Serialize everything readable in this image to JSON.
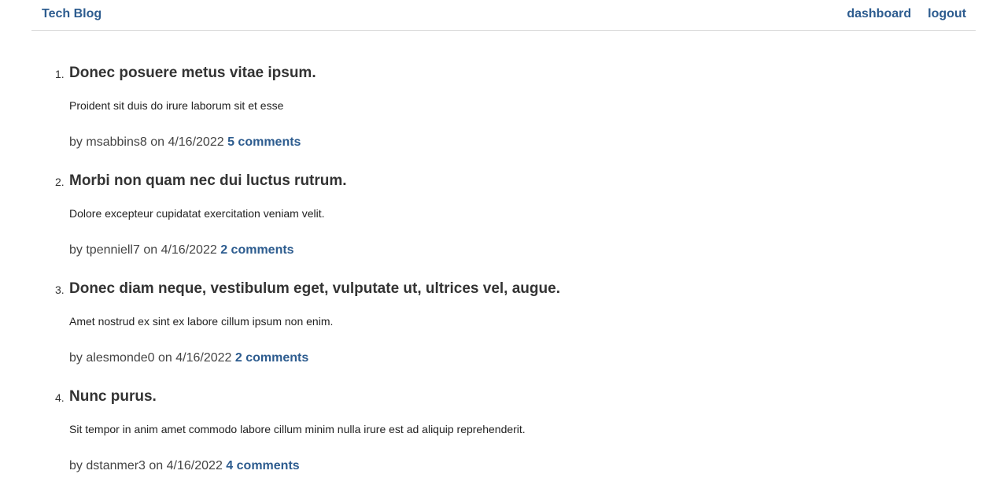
{
  "header": {
    "brand": "Tech Blog",
    "nav": {
      "dashboard": "dashboard",
      "logout": "logout"
    }
  },
  "meta_labels": {
    "by": "by",
    "on": "on"
  },
  "posts": [
    {
      "number": "1.",
      "title": "Donec posuere metus vitae ipsum.",
      "body": "Proident sit duis do irure laborum sit et esse",
      "author": "msabbins8",
      "date": "4/16/2022",
      "comments": "5 comments"
    },
    {
      "number": "2.",
      "title": "Morbi non quam nec dui luctus rutrum.",
      "body": "Dolore excepteur cupidatat exercitation veniam velit.",
      "author": "tpenniell7",
      "date": "4/16/2022",
      "comments": "2 comments"
    },
    {
      "number": "3.",
      "title": "Donec diam neque, vestibulum eget, vulputate ut, ultrices vel, augue.",
      "body": "Amet nostrud ex sint ex labore cillum ipsum non enim.",
      "author": "alesmonde0",
      "date": "4/16/2022",
      "comments": "2 comments"
    },
    {
      "number": "4.",
      "title": "Nunc purus.",
      "body": "Sit tempor in anim amet commodo labore cillum minim nulla irure est ad aliquip reprehenderit.",
      "author": "dstanmer3",
      "date": "4/16/2022",
      "comments": "4 comments"
    }
  ]
}
